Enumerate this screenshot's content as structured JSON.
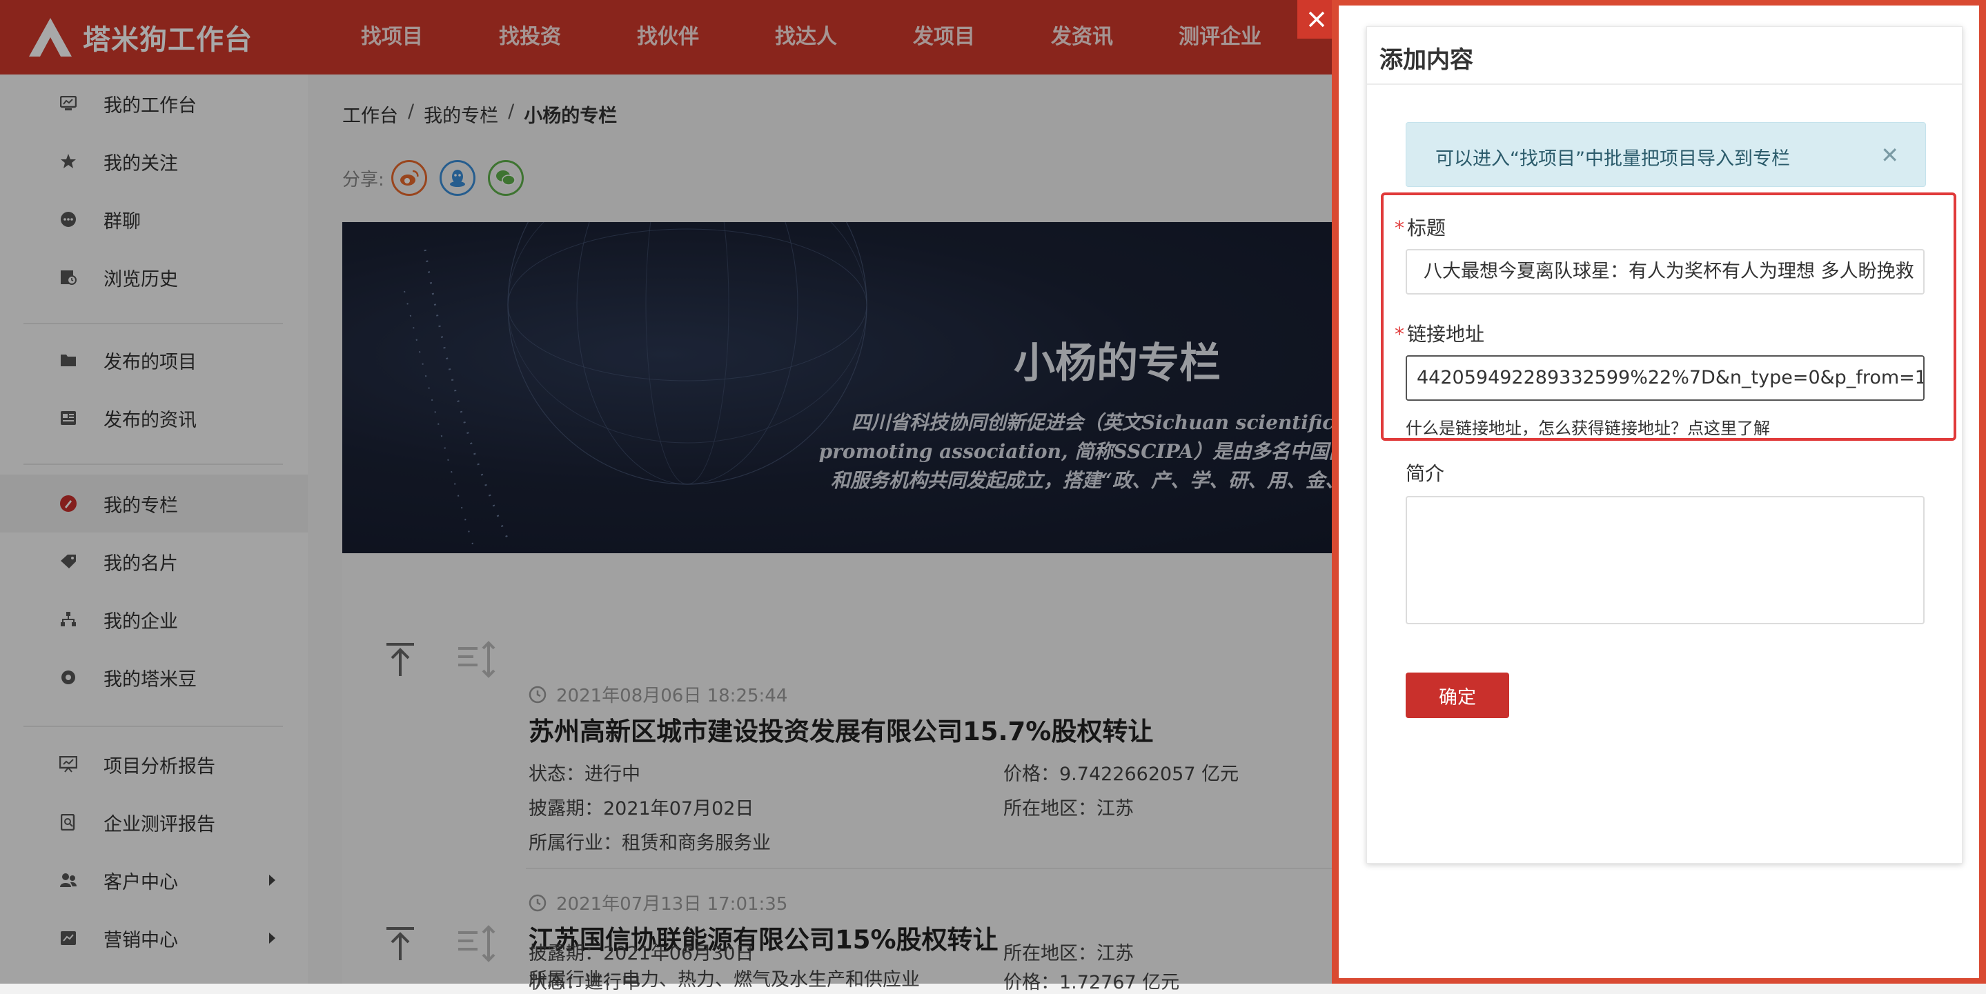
{
  "brand": {
    "name": "塔米狗工作台"
  },
  "nav": [
    "找项目",
    "找投资",
    "找伙伴",
    "找达人",
    "发项目",
    "发资讯",
    "测评企业"
  ],
  "sidebar": {
    "items": [
      {
        "label": "我的工作台",
        "icon": "dashboard-icon"
      },
      {
        "label": "我的关注",
        "icon": "star-icon"
      },
      {
        "label": "群聊",
        "icon": "chat-icon"
      },
      {
        "label": "浏览历史",
        "icon": "history-icon"
      },
      {
        "label": "发布的项目",
        "icon": "folder-icon"
      },
      {
        "label": "发布的资讯",
        "icon": "news-icon"
      },
      {
        "label": "我的专栏",
        "icon": "column-icon"
      },
      {
        "label": "我的名片",
        "icon": "tag-icon"
      },
      {
        "label": "我的企业",
        "icon": "org-icon"
      },
      {
        "label": "我的塔米豆",
        "icon": "bean-icon"
      },
      {
        "label": "项目分析报告",
        "icon": "report-icon"
      },
      {
        "label": "企业测评报告",
        "icon": "search-doc-icon"
      },
      {
        "label": "客户中心",
        "icon": "users-icon"
      },
      {
        "label": "营销中心",
        "icon": "marketing-icon"
      }
    ],
    "active": "我的专栏"
  },
  "breadcrumb": [
    "工作台",
    "我的专栏",
    "小杨的专栏"
  ],
  "share": {
    "label": "分享:",
    "icons": [
      "weibo-icon",
      "qq-icon",
      "wechat-icon"
    ]
  },
  "banner": {
    "title": "小杨的专栏",
    "desc_line1": "四川省科技协同创新促进会（英文Sichuan scientific colla",
    "desc_line2": "promoting association, 简称SSCIPA）是由多名中国两院院士、",
    "desc_line3": "和服务机构共同发起成立，搭建“政、产、学、研、用、金、服”融合"
  },
  "projects": [
    {
      "time": "2021年08月06日 18:25:44",
      "title": "苏州高新区城市建设投资发展有限公司15.7%股权转让",
      "status": "状态：进行中",
      "price": "价格：9.7422662057 亿元",
      "disclose": "披露期：2021年07月02日",
      "region": "所在地区：江苏",
      "industry": "所属行业：租赁和商务服务业"
    },
    {
      "time": "2021年07月13日 17:01:35",
      "title": "江苏国信协联能源有限公司15%股权转让",
      "status": "状态：进行中",
      "price": "价格：1.72767 亿元",
      "disclose": "披露期：2021年06月30日",
      "region": "所在地区：江苏",
      "industry": "所属行业：电力、热力、燃气及水生产和供应业"
    }
  ],
  "drawer": {
    "title": "添加内容",
    "alert": "可以进入“找项目”中批量把项目导入到专栏",
    "title_label": "标题",
    "title_value": "八大最想今夏离队球星：有人为奖杯有人为理想 多人盼挽救",
    "link_label": "链接地址",
    "link_value": "442059492289332599%22%7D&n_type=0&p_from=1",
    "help": "什么是链接地址，怎么获得链接地址？点这里了解",
    "intro_label": "简介",
    "intro_value": "",
    "submit": "确定"
  },
  "colors": {
    "brand": "#d0392b",
    "highlight": "#e03a3a",
    "alert_bg": "#d8ecf2"
  }
}
